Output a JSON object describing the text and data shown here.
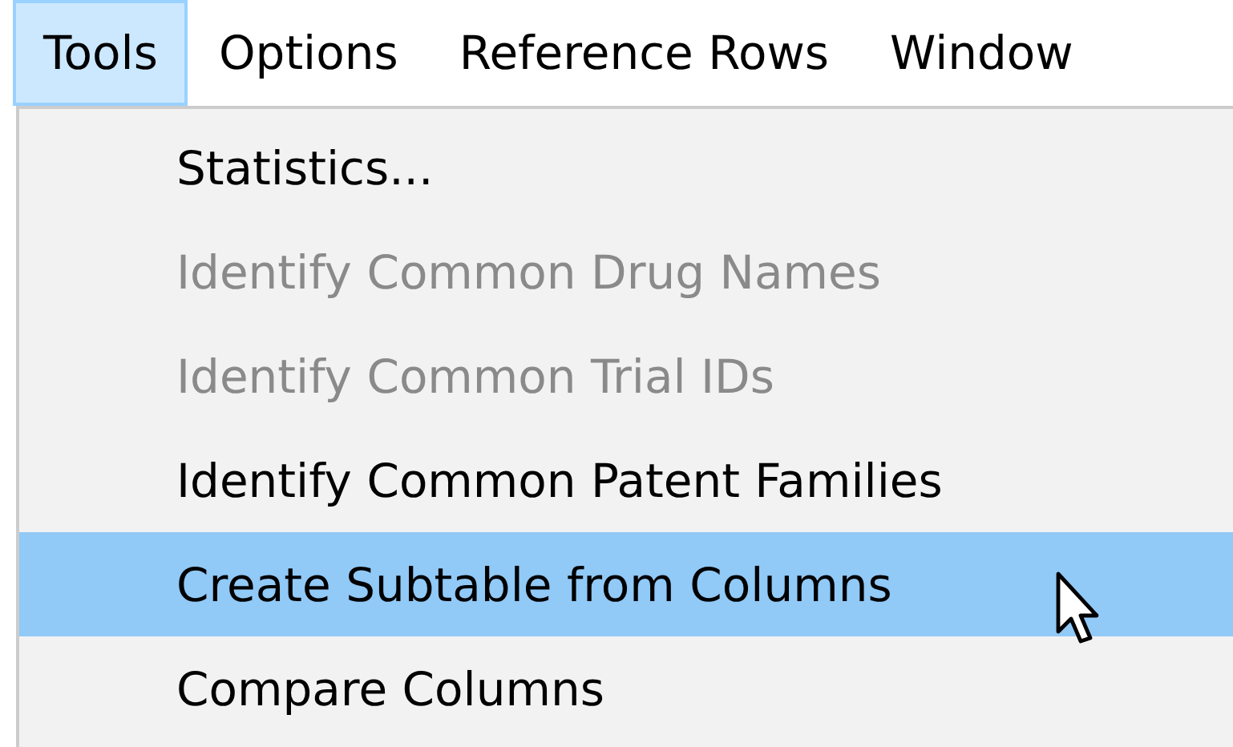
{
  "menu_bar": [
    {
      "label": "Tools",
      "selected": true
    },
    {
      "label": "Options",
      "selected": false
    },
    {
      "label": "Reference Rows",
      "selected": false
    },
    {
      "label": "Window",
      "selected": false
    }
  ],
  "dropdown": {
    "items": [
      {
        "label": "Statistics...",
        "disabled": false,
        "selected": false
      },
      {
        "label": "Identify Common Drug Names",
        "disabled": true,
        "selected": false
      },
      {
        "label": "Identify Common Trial IDs",
        "disabled": true,
        "selected": false
      },
      {
        "label": "Identify Common Patent Families",
        "disabled": false,
        "selected": false
      },
      {
        "label": "Create Subtable from Columns",
        "disabled": false,
        "selected": true
      },
      {
        "label": "Compare Columns",
        "disabled": false,
        "selected": false
      }
    ]
  }
}
